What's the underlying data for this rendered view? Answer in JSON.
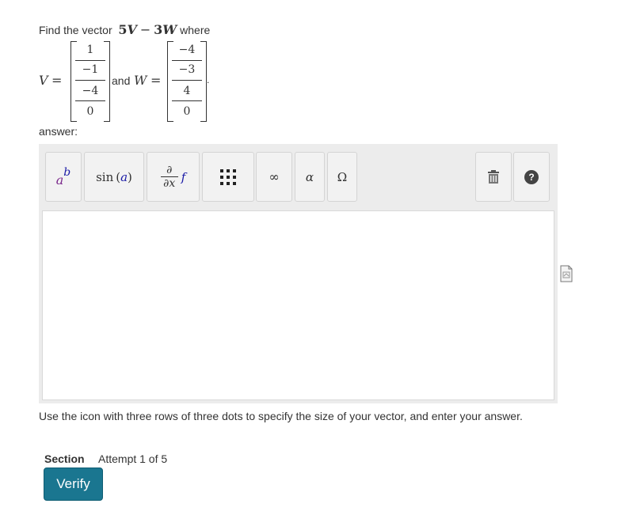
{
  "question": {
    "prefix": "Find the vector",
    "expr_a": "5",
    "expr_v": "V",
    "expr_minus": "−",
    "expr_b": "3",
    "expr_w": "W",
    "suffix": "where",
    "v_label": "V",
    "equals": "=",
    "and_text": "and",
    "w_label": "W",
    "period": ".",
    "V": [
      "1",
      "−1",
      "−4",
      "0"
    ],
    "W": [
      "−4",
      "−3",
      "4",
      "0"
    ]
  },
  "answer_label": "answer:",
  "toolbar": {
    "sup_base": "a",
    "sup_exp": "b",
    "trig_fn": "sin",
    "trig_arg": "a",
    "deriv_num": "∂",
    "deriv_den": "∂x",
    "deriv_f": "f",
    "infinity": "∞",
    "alpha": "α",
    "omega": "Ω",
    "help": "?"
  },
  "help_text": "Use the icon with three rows of three dots to specify the size of your vector, and enter your answer.",
  "section_label": "Section",
  "attempt_text": "Attempt 1 of 5",
  "verify_label": "Verify",
  "colors": {
    "verify_bg": "#1a7690",
    "superscript_base": "#7b2a8c",
    "superscript_exp": "#1a1aa6",
    "trig_arg": "#1a1aa6",
    "deriv_f": "#1a1aa6"
  }
}
